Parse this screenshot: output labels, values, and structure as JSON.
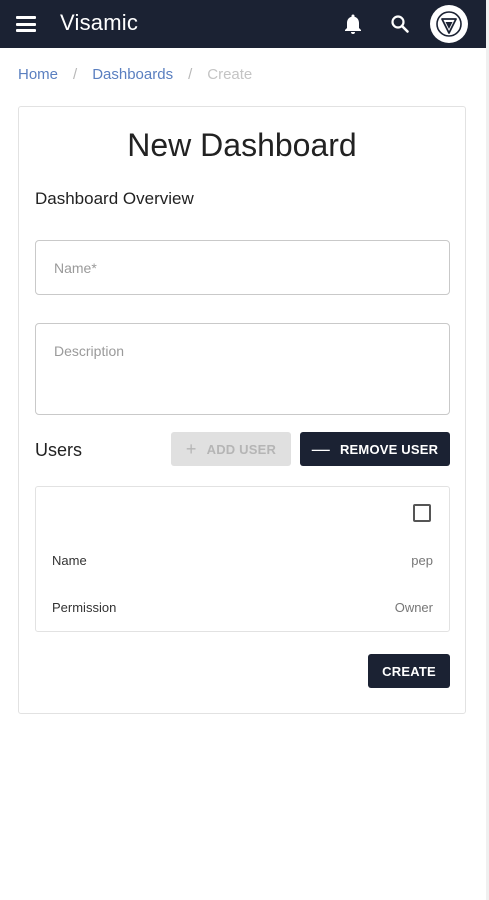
{
  "header": {
    "app_title": "Visamic",
    "menu_icon": "hamburger-icon",
    "notifications_icon": "bell-icon",
    "search_icon": "search-icon",
    "avatar_icon": "logo-icon"
  },
  "breadcrumb": {
    "items": [
      "Home",
      "Dashboards",
      "Create"
    ],
    "separator": "/"
  },
  "form": {
    "title": "New Dashboard",
    "section_title": "Dashboard Overview",
    "name_placeholder": "Name*",
    "description_placeholder": "Description"
  },
  "users": {
    "label": "Users",
    "add_user_label": "ADD USER",
    "remove_user_label": "REMOVE USER",
    "entries": [
      {
        "name_label": "Name",
        "name_value": "pep",
        "permission_label": "Permission",
        "permission_value": "Owner"
      }
    ]
  },
  "actions": {
    "create_label": "CREATE"
  },
  "colors": {
    "topbar": "#1b2233",
    "link": "#5a7fc0",
    "disabled_button": "#e0e0e0"
  }
}
